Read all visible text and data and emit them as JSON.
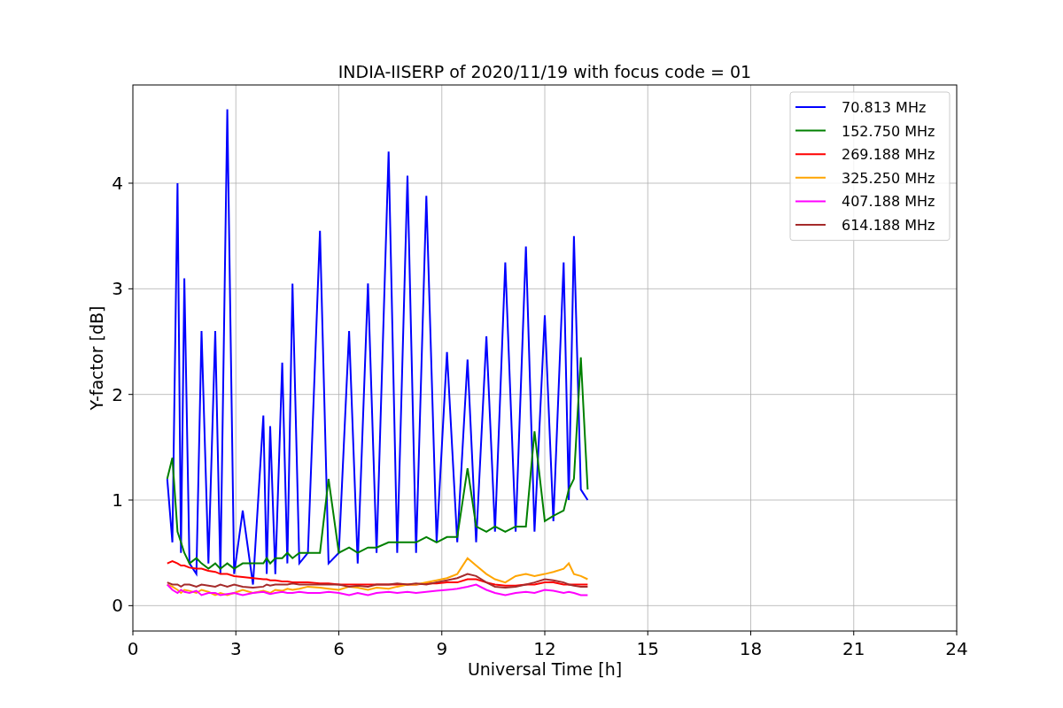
{
  "chart_data": {
    "type": "line",
    "title": "INDIA-IISERP of 2020/11/19 with focus code = 01",
    "xlabel": "Universal Time [h]",
    "ylabel": "Y-factor [dB]",
    "x": [
      1.0,
      1.15,
      1.3,
      1.4,
      1.5,
      1.65,
      1.85,
      2.0,
      2.2,
      2.4,
      2.55,
      2.75,
      2.95,
      3.2,
      3.5,
      3.8,
      3.9,
      4.0,
      4.15,
      4.35,
      4.5,
      4.65,
      4.85,
      5.1,
      5.45,
      5.7,
      6.0,
      6.3,
      6.55,
      6.85,
      7.1,
      7.45,
      7.7,
      8.0,
      8.25,
      8.55,
      8.85,
      9.15,
      9.45,
      9.75,
      10.0,
      10.3,
      10.55,
      10.85,
      11.15,
      11.45,
      11.7,
      12.0,
      12.25,
      12.55,
      12.7,
      12.85,
      13.05,
      13.25
    ],
    "series": [
      {
        "name": "70.813 MHz",
        "color": "#0000ff",
        "values": [
          1.2,
          0.6,
          4.0,
          0.5,
          3.1,
          0.4,
          0.3,
          2.6,
          0.4,
          2.6,
          0.3,
          4.7,
          0.3,
          0.9,
          0.2,
          1.8,
          0.3,
          1.7,
          0.3,
          2.3,
          0.4,
          3.05,
          0.4,
          0.5,
          3.55,
          0.4,
          0.5,
          2.6,
          0.4,
          3.05,
          0.5,
          4.3,
          0.5,
          4.07,
          0.5,
          3.88,
          0.6,
          2.4,
          0.6,
          2.33,
          0.6,
          2.55,
          0.7,
          3.25,
          0.7,
          3.4,
          0.7,
          2.75,
          0.8,
          3.25,
          1.0,
          3.5,
          1.1,
          1.0
        ]
      },
      {
        "name": "152.750 MHz",
        "color": "#008000",
        "values": [
          1.2,
          1.4,
          0.7,
          0.6,
          0.5,
          0.4,
          0.45,
          0.4,
          0.35,
          0.4,
          0.35,
          0.4,
          0.35,
          0.4,
          0.4,
          0.4,
          0.45,
          0.4,
          0.45,
          0.45,
          0.5,
          0.45,
          0.5,
          0.5,
          0.5,
          1.2,
          0.5,
          0.55,
          0.5,
          0.55,
          0.55,
          0.6,
          0.6,
          0.6,
          0.6,
          0.65,
          0.6,
          0.65,
          0.65,
          1.3,
          0.75,
          0.7,
          0.75,
          0.7,
          0.75,
          0.75,
          1.65,
          0.8,
          0.85,
          0.9,
          1.1,
          1.2,
          2.35,
          1.1
        ]
      },
      {
        "name": "269.188 MHz",
        "color": "#ff0000",
        "values": [
          0.4,
          0.42,
          0.4,
          0.38,
          0.38,
          0.36,
          0.35,
          0.35,
          0.33,
          0.32,
          0.3,
          0.3,
          0.28,
          0.27,
          0.26,
          0.25,
          0.25,
          0.24,
          0.24,
          0.23,
          0.23,
          0.22,
          0.22,
          0.22,
          0.21,
          0.21,
          0.2,
          0.2,
          0.2,
          0.2,
          0.2,
          0.2,
          0.2,
          0.2,
          0.2,
          0.21,
          0.21,
          0.22,
          0.22,
          0.25,
          0.25,
          0.22,
          0.2,
          0.19,
          0.19,
          0.2,
          0.2,
          0.22,
          0.22,
          0.2,
          0.2,
          0.2,
          0.2,
          0.2
        ]
      },
      {
        "name": "325.250 MHz",
        "color": "#ffa500",
        "values": [
          0.2,
          0.18,
          0.15,
          0.12,
          0.15,
          0.14,
          0.12,
          0.15,
          0.13,
          0.1,
          0.12,
          0.1,
          0.12,
          0.15,
          0.12,
          0.14,
          0.13,
          0.12,
          0.15,
          0.14,
          0.16,
          0.15,
          0.16,
          0.18,
          0.17,
          0.16,
          0.15,
          0.18,
          0.17,
          0.15,
          0.17,
          0.16,
          0.18,
          0.2,
          0.2,
          0.22,
          0.24,
          0.26,
          0.3,
          0.45,
          0.38,
          0.3,
          0.25,
          0.22,
          0.28,
          0.3,
          0.28,
          0.3,
          0.32,
          0.35,
          0.4,
          0.3,
          0.28,
          0.25
        ]
      },
      {
        "name": "407.188 MHz",
        "color": "#ff00ff",
        "values": [
          0.2,
          0.15,
          0.12,
          0.15,
          0.13,
          0.12,
          0.14,
          0.1,
          0.12,
          0.12,
          0.1,
          0.11,
          0.12,
          0.1,
          0.12,
          0.13,
          0.12,
          0.11,
          0.12,
          0.13,
          0.12,
          0.12,
          0.13,
          0.12,
          0.12,
          0.13,
          0.12,
          0.1,
          0.12,
          0.1,
          0.12,
          0.13,
          0.12,
          0.13,
          0.12,
          0.13,
          0.14,
          0.15,
          0.16,
          0.18,
          0.2,
          0.15,
          0.12,
          0.1,
          0.12,
          0.13,
          0.12,
          0.15,
          0.14,
          0.12,
          0.13,
          0.12,
          0.1,
          0.1
        ]
      },
      {
        "name": "614.188 MHz",
        "color": "#a52a2a",
        "values": [
          0.22,
          0.2,
          0.2,
          0.18,
          0.2,
          0.2,
          0.18,
          0.2,
          0.19,
          0.18,
          0.2,
          0.18,
          0.2,
          0.18,
          0.17,
          0.18,
          0.2,
          0.19,
          0.2,
          0.2,
          0.2,
          0.21,
          0.2,
          0.2,
          0.2,
          0.2,
          0.2,
          0.18,
          0.19,
          0.18,
          0.2,
          0.2,
          0.21,
          0.2,
          0.21,
          0.2,
          0.22,
          0.24,
          0.26,
          0.3,
          0.28,
          0.22,
          0.18,
          0.17,
          0.18,
          0.2,
          0.22,
          0.25,
          0.24,
          0.22,
          0.2,
          0.19,
          0.18,
          0.18
        ]
      }
    ],
    "grid": true,
    "legend": true,
    "xlim": [
      0,
      24
    ],
    "ylim": [
      -0.24,
      4.93
    ],
    "xticks": [
      0,
      3,
      6,
      9,
      12,
      15,
      18,
      21,
      24
    ],
    "yticks": [
      0,
      1,
      2,
      3,
      4
    ]
  }
}
